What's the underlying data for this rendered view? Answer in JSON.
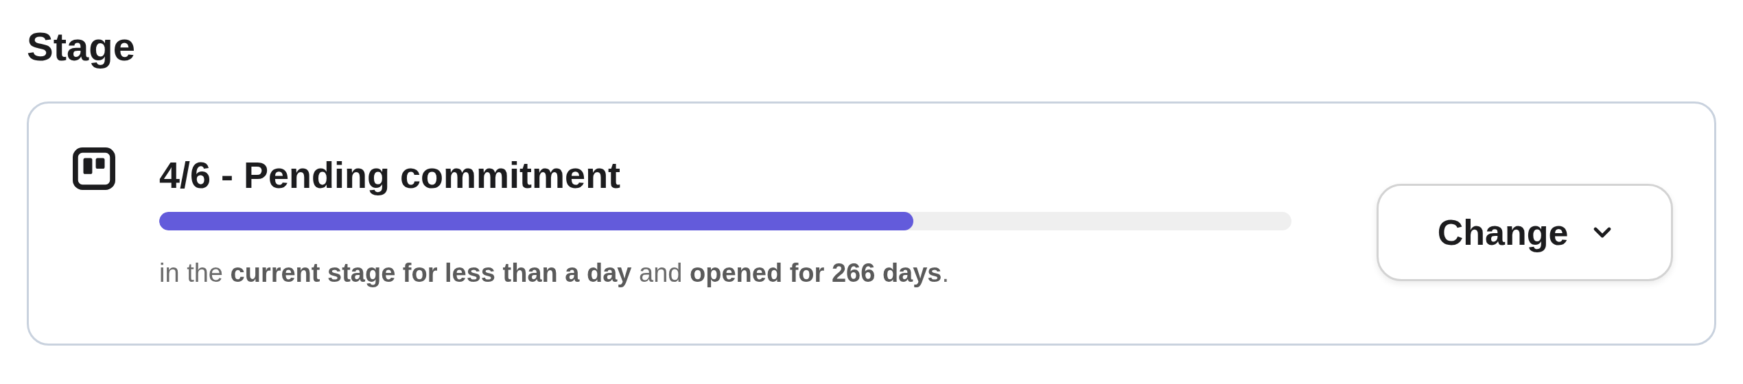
{
  "section_title": "Stage",
  "stage": {
    "title": "4/6 - Pending commitment",
    "level": 0.666,
    "description": "in the **current stage for less than a day** and **opened for 266 days**.",
    "button": {
      "label": "Change"
    }
  }
}
